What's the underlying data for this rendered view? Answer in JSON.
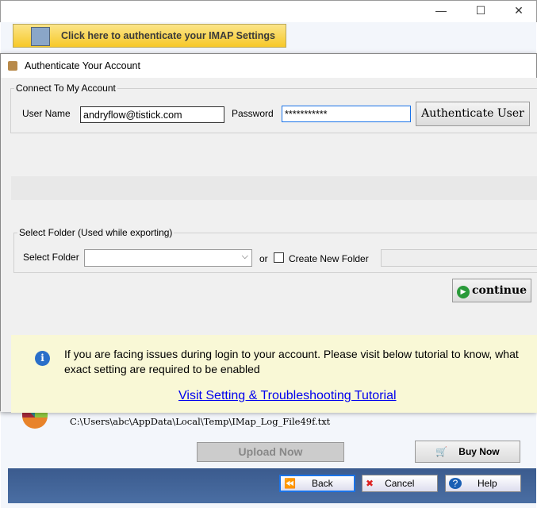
{
  "window": {
    "minimize": "—",
    "maximize": "☐",
    "close": "✕"
  },
  "imap_button": "Click here to authenticate your IMAP Settings",
  "dialog": {
    "title": "Authenticate Your Account",
    "connect": {
      "legend": "Connect To My Account",
      "user_label": "User Name",
      "user_value": "andryflow@tistick.com",
      "password_label": "Password",
      "password_value": "***********",
      "auth_button": "Authenticate User"
    },
    "folder": {
      "legend": "Select Folder (Used while exporting)",
      "select_label": "Select Folder",
      "select_value": "",
      "or": "or",
      "create_label": "Create New Folder",
      "create_checked": false,
      "new_folder_value": ""
    },
    "continue": "continue",
    "info": {
      "message": "If you are facing issues during login to your account. Please visit below tutorial to know, what exact setting are required to be enabled",
      "link": "Visit Setting & Troubleshooting Tutorial"
    }
  },
  "log_path": "C:\\Users\\abc\\AppData\\Local\\Temp\\IMap_Log_File49f.txt",
  "upload_button": "Upload Now",
  "buy_button": "Buy Now",
  "nav": {
    "back": "Back",
    "cancel": "Cancel",
    "help": "Help"
  }
}
